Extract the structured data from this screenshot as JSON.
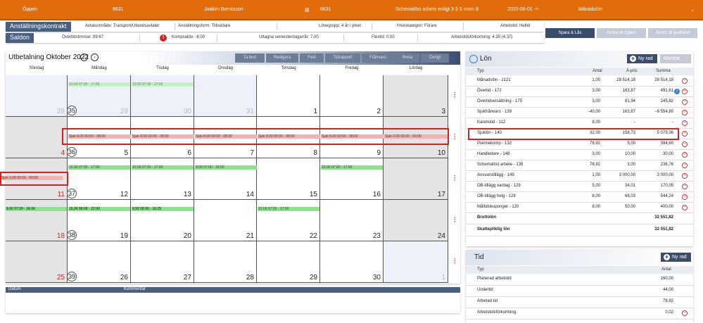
{
  "topbar": {
    "name": "Öppen",
    "id": "6631",
    "employee": "Joakim Berntsson",
    "id2": "6631",
    "schedule": "Schemalöst arbete enligt 3 § 5 mom 8",
    "date": "2020-06-01 ->",
    "salary_type": "Månadslön"
  },
  "contract": {
    "label": "Anställningskontrakt",
    "avtal": "Avtalsområde: Transport/Utlandsavtalet",
    "form": "Anställningsform: Tillsvidare",
    "lonegrupp": "Lönegrupp: 4 år i yrket",
    "yrke": "Yrkeskategori: Förare",
    "arbetstid": "Arbetstid: Heltid"
  },
  "saldon": {
    "label": "Saldon",
    "overtid": "Övertidstimmar: 89:67",
    "komp": "Kompsaldo: -8:00",
    "semester": "Uttagna semesterdagar/år: 7,00",
    "flextid": "Flextid: 0:00",
    "atf": "Arbetstidsförkortning: 4.35 (4.37)"
  },
  "actions": {
    "spara": "Spara & Lås",
    "andra_oppen": "Ändra till öppen",
    "andra_godkand": "Ändra till godkänd"
  },
  "calendar": {
    "title": "Utbetalning Oktober 2022",
    "toolbar": [
      "Ta bort",
      "Redigera",
      "Fest",
      "Tidrapport",
      "Frånvaro",
      "Resa",
      "Övrigt"
    ],
    "days": [
      "Söndag",
      "Måndag",
      "Tisdag",
      "Onsdag",
      "Torsdag",
      "Fredag",
      "Lördag"
    ],
    "weeks": [
      "35",
      "36",
      "37",
      "38",
      "39"
    ],
    "numbers": [
      [
        "28",
        "29",
        "30",
        "31",
        "1",
        "2",
        "3"
      ],
      [
        "4",
        "5",
        "6",
        "7",
        "8",
        "9",
        "10"
      ],
      [
        "11",
        "12",
        "13",
        "14",
        "15",
        "16",
        "17"
      ],
      [
        "18",
        "19",
        "20",
        "21",
        "22",
        "23",
        "24"
      ],
      [
        "25",
        "26",
        "27",
        "28",
        "29",
        "30",
        "1"
      ]
    ],
    "entries": {
      "w1_mon": "10.00 07:00 - 17:00",
      "w1_tue": "10.00 07:00 - 17:00",
      "sick_mon": "Sjuk 8.00 00:00 - 08:00",
      "sick_tue": "Sjuk 8.00 00:00 - 08:00",
      "sick_wed": "Sjuk 8.00 00:00 - 08:00",
      "sick_thu": "Sjuk 8.00 00:00 - 08:00",
      "sick_fri": "Sjuk 8.00 00:00 - 08:00",
      "sick_sat": "Sjuk 0.00 00:00 - 00:00",
      "sick_sun11": "Sjuk 0.00 00:00 - 00:00",
      "w3_mon": "10.00 07:00 - 17:00",
      "w3_tue": "10.00 07:00 - 17:00",
      "w3_wed": "8.00 07:00 - 16:00",
      "w3_fri": "10.00 07:00 - 17:00",
      "w4_sun": "8.00 07:00 - 16:00",
      "w4_mon": "15,00 08:00 - 23:00",
      "w4_tue": "9,92 06:00 - 16:25",
      "w4_thu": "10.00 07:00 - 17:00"
    },
    "comment_cols": [
      "Datum",
      "Kommentar"
    ]
  },
  "lon": {
    "title": "Lön",
    "add": "Ny rad",
    "attest": "Attestat",
    "cols": [
      "Typ",
      "Antal",
      "À-pris",
      "Summa"
    ],
    "rows": [
      {
        "typ": "Månadslön - z121",
        "antal": "1,00",
        "apris": "28 514,18",
        "summa": "28 514,18"
      },
      {
        "typ": "Övertid - 172",
        "antal": "3,00",
        "apris": "163,87",
        "summa": "491,61"
      },
      {
        "typ": "Övertidsersättning - 175",
        "antal": "3,00",
        "apris": "81,94",
        "summa": "245,82"
      },
      {
        "typ": "Sjukfrånvaro - 139",
        "antal": "-40,00",
        "apris": "163,87",
        "summa": "-6 554,80"
      },
      {
        "typ": "Karenstid - 112",
        "antal": "8,00",
        "apris": "-",
        "summa": "-"
      },
      {
        "typ": "Sjuklön - 140",
        "antal": "32,00",
        "apris": "158,73",
        "summa": "5 079,36"
      },
      {
        "typ": "Premiekomp - 132",
        "antal": "78,92",
        "apris": "5,00",
        "summa": "394,60"
      },
      {
        "typ": "Handledare - 148",
        "antal": "3,00",
        "apris": "10,00",
        "summa": "30,00"
      },
      {
        "typ": "Schemalöst arbete - 135",
        "antal": "78,92",
        "apris": "3,00",
        "summa": "236,76"
      },
      {
        "typ": "Ansvarstillägg - 149",
        "antal": "1,00",
        "apris": "3 000,00",
        "summa": "3 000,00"
      },
      {
        "typ": "OB-tillägg vardag - 129",
        "antal": "5,00",
        "apris": "34,01",
        "summa": "170,05"
      },
      {
        "typ": "OB-tillägg helg - 128",
        "antal": "8,00",
        "apris": "68,03",
        "summa": "544,24"
      },
      {
        "typ": "Måltidskuponger - 120",
        "antal": "8,00",
        "apris": "50,00",
        "summa": "400,00"
      }
    ],
    "brutto_label": "Bruttolön",
    "brutto": "32 551,82",
    "skatt_label": "Skattepliktig lön",
    "skatt": "32 551,82"
  },
  "tid": {
    "title": "Tid",
    "add": "Ny rad",
    "cols": [
      "Typ",
      "Antal"
    ],
    "rows": [
      {
        "typ": "Planerad arbetstid",
        "antal": "160,00"
      },
      {
        "typ": "Undertid",
        "antal": "44,00"
      },
      {
        "typ": "Arbetad tid",
        "antal": "78,92"
      },
      {
        "typ": "Arbetstidsförkortning",
        "antal": "0,02"
      }
    ]
  },
  "colors": {
    "orange": "#e36c0a",
    "navy": "#3b4c6b",
    "highlight": "#d62020"
  }
}
